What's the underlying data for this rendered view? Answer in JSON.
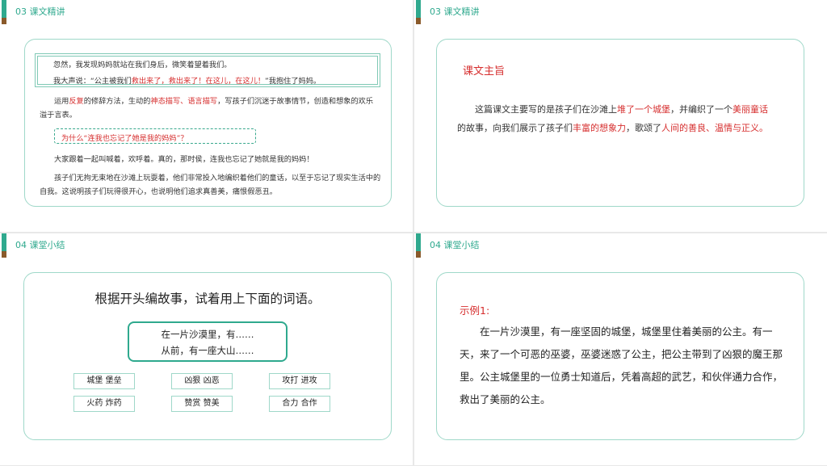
{
  "slides": [
    {
      "header": "03 课文精讲",
      "quote": {
        "line1": "忽然，我发现妈妈就站在我们身后，微笑着望着我们。",
        "line2_pre": "我大声说：“公主被我们",
        "line2_red": "救出来了，救出来了！在这儿，在这儿！",
        "line2_post": "”我抱住了妈妈。"
      },
      "para1": {
        "t1": "运用",
        "r1": "反复",
        "t2": "的修辞方法，生动的",
        "r2": "神态描写、语言描写",
        "t3": "，写孩子们沉迷于故事情节，创造和想象的欢乐溢于言表。"
      },
      "question": "为什么“连我也忘记了她是我的妈妈”？",
      "para2": "大家跟着一起叫喊着，欢呼着。真的，那时侯，连我也忘记了她就是我的妈妈！",
      "para3": "孩子们无拘无束地在沙滩上玩耍着，他们非常投入地编织着他们的童话，以至于忘记了现实生活中的自我。这说明孩子们玩得很开心，也说明他们追求真善美，痛恨假恶丑。"
    },
    {
      "header": "03 课文精讲",
      "title": "课文主旨",
      "text": {
        "t1": "这篇课文主要写的是孩子们在沙滩上",
        "r1": "堆了一个城堡",
        "t2": "，并编织了一个",
        "r2": "美丽童话",
        "t3": "的故事，向我们展示了孩子们",
        "r3": "丰富的想象力",
        "t4": "，歌颂了",
        "r4": "人间的善良、温情与正义。"
      }
    },
    {
      "header": "04 课堂小结",
      "title": "根据开头编故事，试着用上下面的词语。",
      "start_lines": [
        "在一片沙漠里，有……",
        "从前，有一座大山……"
      ],
      "words": [
        "城堡  堡垒",
        "凶狠  凶恶",
        "攻打  进攻",
        "火药  炸药",
        "赞赏  赞美",
        "合力  合作"
      ]
    },
    {
      "header": "04 课堂小结",
      "example_title": "示例1:",
      "example_text": "在一片沙漠里，有一座坚固的城堡，城堡里住着美丽的公主。有一天，来了一个可恶的巫婆，巫婆迷惑了公主，把公主带到了凶狠的魔王那里。公主城堡里的一位勇士知道后，凭着高超的武艺，和伙伴通力合作，救出了美丽的公主。"
    }
  ],
  "colors": {
    "accent": "#2fa98e",
    "accent_dark": "#8a5a2b",
    "highlight": "#d62e2e",
    "card_border": "#9fd8c9"
  }
}
